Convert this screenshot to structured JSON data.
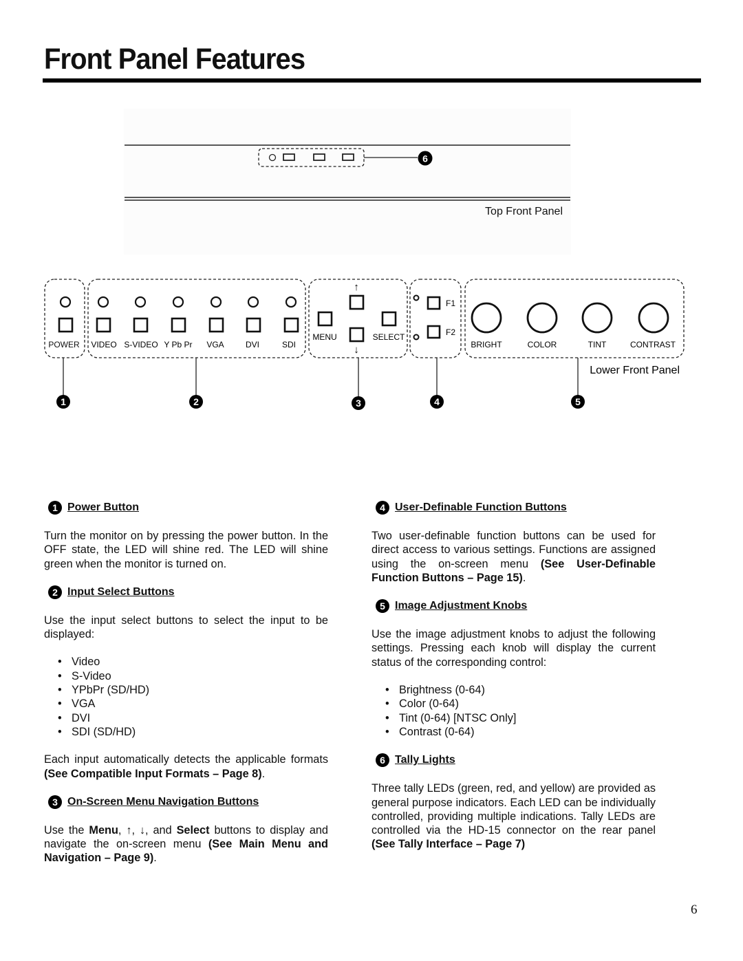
{
  "page": {
    "title": "Front Panel Features",
    "page_number": "6"
  },
  "diagram": {
    "top_panel": {
      "caption": "Top Front Panel",
      "callout": "6",
      "tally_leds": [
        "led",
        "tally-1",
        "tally-2",
        "tally-3"
      ]
    },
    "lower_panel": {
      "caption": "Lower Front Panel",
      "power_label": "POWER",
      "input_labels": [
        "VIDEO",
        "S-VIDEO",
        "Y Pb Pr",
        "VGA",
        "DVI",
        "SDI"
      ],
      "menu_label": "MENU",
      "select_label": "SELECT",
      "up_arrow": "↑",
      "down_arrow": "↓",
      "function_labels": [
        "F1",
        "F2"
      ],
      "knob_labels": [
        "BRIGHT",
        "COLOR",
        "TINT",
        "CONTRAST"
      ],
      "callouts": [
        "1",
        "2",
        "3",
        "4",
        "5"
      ]
    }
  },
  "sections": {
    "power": {
      "num": "1",
      "title": "Power Button",
      "body": "Turn the monitor on by pressing the power button. In the OFF state, the LED will shine red. The LED will shine green when the monitor is turned on."
    },
    "input": {
      "num": "2",
      "title": "Input Select Buttons",
      "intro": "Use the input select buttons to select the input to be displayed:",
      "items": [
        "Video",
        "S-Video",
        "YPbPr (SD/HD)",
        "VGA",
        "DVI",
        "SDI (SD/HD)"
      ],
      "outro_pre": "Each input automatically detects the applicable formats ",
      "outro_ref": "(See Compatible Input Formats – Page 8)",
      "outro_post": "."
    },
    "menu": {
      "num": "3",
      "title": "On-Screen Menu Navigation Buttons",
      "t1": "Use the ",
      "b1": "Menu",
      "t2": ", ↑, ↓, and ",
      "b2": "Select",
      "t3": " buttons to display and navigate the on-screen menu ",
      "ref": "(See Main Menu and Navigation – Page 9)",
      "t4": "."
    },
    "function": {
      "num": "4",
      "title": "User-Definable Function Buttons",
      "body_pre": "Two user-definable function buttons can be used for direct access to various settings. Functions are assigned using the on-screen menu ",
      "ref": "(See User-Definable Function Buttons – Page 15)",
      "body_post": "."
    },
    "knobs": {
      "num": "5",
      "title": "Image Adjustment Knobs",
      "intro": "Use the image adjustment knobs to adjust the following settings. Pressing each knob will display the current status of the corresponding control:",
      "items": [
        "Brightness (0-64)",
        "Color (0-64)",
        "Tint (0-64) [NTSC Only]",
        "Contrast (0-64)"
      ]
    },
    "tally": {
      "num": "6",
      "title": "Tally Lights",
      "body_pre": "Three tally LEDs (green, red, and yellow) are provided as general purpose indicators. Each LED can be individually controlled, providing multiple indications. Tally LEDs are controlled via the HD-15 connector on the rear panel ",
      "ref": "(See Tally Interface – Page 7)"
    }
  }
}
